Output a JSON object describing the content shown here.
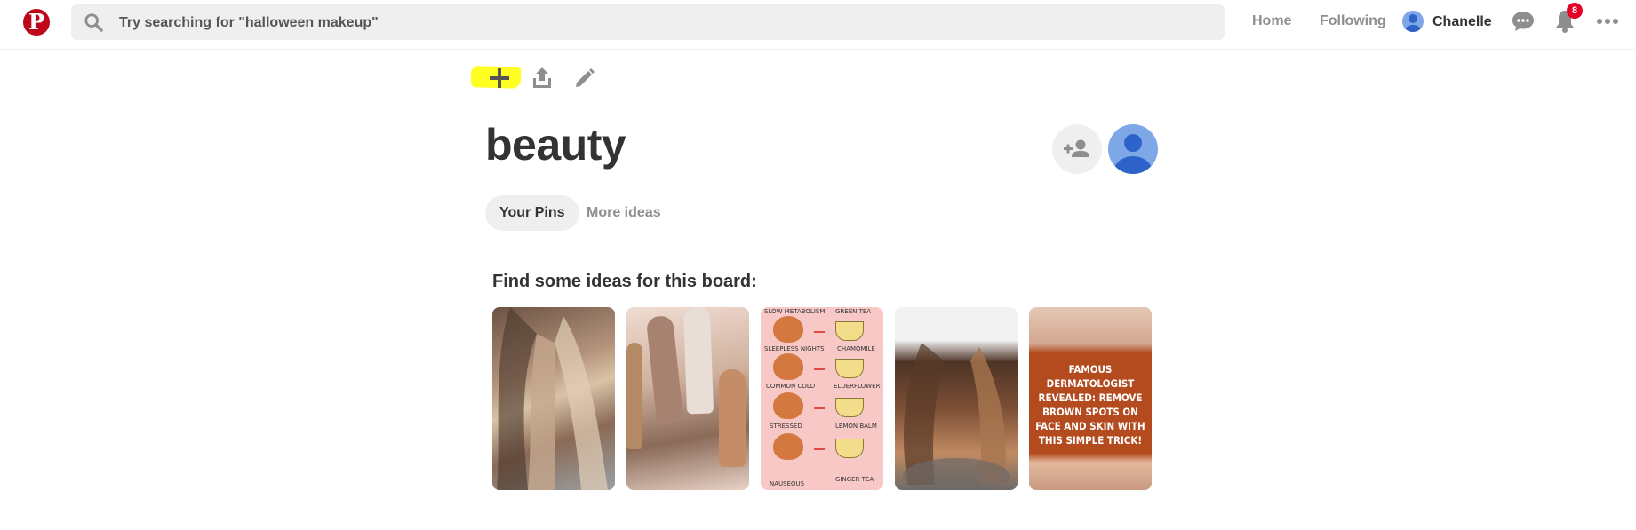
{
  "header": {
    "logo": "P",
    "search_placeholder": "Try searching for \"halloween makeup\"",
    "nav": {
      "home": "Home",
      "following": "Following"
    },
    "user_name": "Chanelle",
    "notifications_count": "8"
  },
  "board": {
    "title": "beauty",
    "tabs": [
      {
        "label": "Your Pins",
        "active": true
      },
      {
        "label": "More ideas",
        "active": false
      }
    ]
  },
  "ideas": {
    "heading": "Find some ideas for this board:",
    "pins": [
      {
        "subject": "balayage hair"
      },
      {
        "subject": "nude nails"
      },
      {
        "subject": "tea chart",
        "rows": [
          {
            "left": "SLOW METABOLISM",
            "right": "GREEN TEA"
          },
          {
            "left": "SLEEPLESS NIGHTS",
            "right": "CHAMOMILE"
          },
          {
            "left": "COMMON COLD",
            "right": "ELDERFLOWER"
          },
          {
            "left": "STRESSED",
            "right": "LEMON BALM"
          },
          {
            "left": "NAUSEOUS",
            "right": "GINGER TEA"
          }
        ]
      },
      {
        "subject": "brunette hair"
      },
      {
        "subject": "dermatologist ad",
        "caption": "FAMOUS DERMATOLOGIST REVEALED: REMOVE BROWN SPOTS ON FACE AND SKIN WITH THIS SIMPLE TRICK!"
      }
    ]
  },
  "colors": {
    "brand": "#bd081c",
    "highlight": "#ffff21",
    "badge": "#e60023"
  }
}
